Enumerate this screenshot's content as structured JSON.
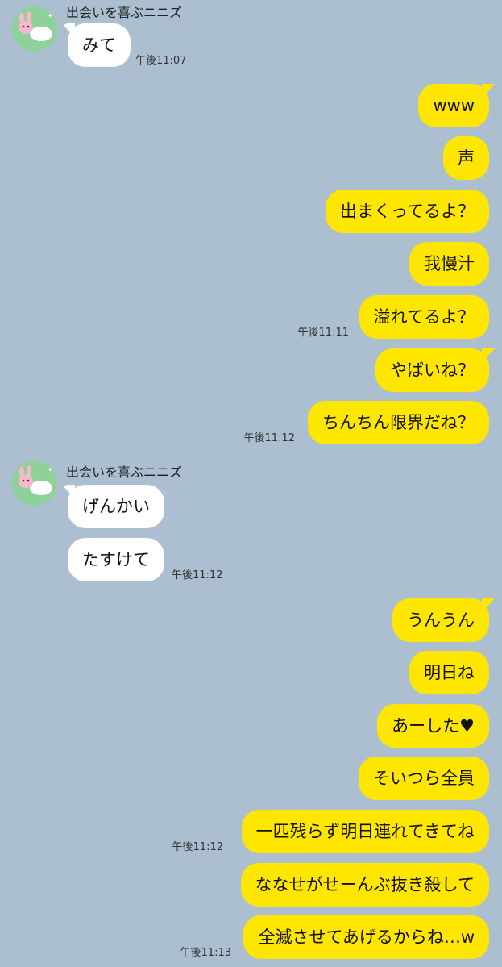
{
  "groups": [
    {
      "sender": "出会いを喜ぶニニズ",
      "messages": [
        {
          "text": "みて",
          "time": "午後11:07"
        }
      ]
    },
    {
      "outgoing": [
        {
          "text": "www"
        },
        {
          "text": "声"
        },
        {
          "text": "出まくってるよ？"
        },
        {
          "text": "我慢汁"
        },
        {
          "text": "溢れてるよ？",
          "time": "午後11:11"
        },
        {
          "text": "やばいね？"
        },
        {
          "text": "ちんちん限界だね？",
          "time": "午後11:12"
        }
      ]
    },
    {
      "sender": "出会いを喜ぶニニズ",
      "messages": [
        {
          "text": "げんかい"
        },
        {
          "text": "たすけて",
          "time": "午後11:12"
        }
      ]
    },
    {
      "outgoing": [
        {
          "text": "うんうん"
        },
        {
          "text": "明日ね"
        },
        {
          "text": "あーした♥"
        },
        {
          "text": "そいつら全員"
        },
        {
          "text": "一匹残らず明日連れてきてね",
          "time": "午後11:12"
        },
        {
          "text": "ななせがせーんぶ抜き殺して"
        },
        {
          "text": "全滅させてあげるからね…w",
          "time": "午後11:13"
        }
      ]
    }
  ],
  "colors": {
    "background": "#abbfd0",
    "incoming_bubble": "#ffffff",
    "outgoing_bubble": "#ffe600"
  },
  "icons": {
    "avatar": "avatar-icon-pink-rabbit"
  }
}
